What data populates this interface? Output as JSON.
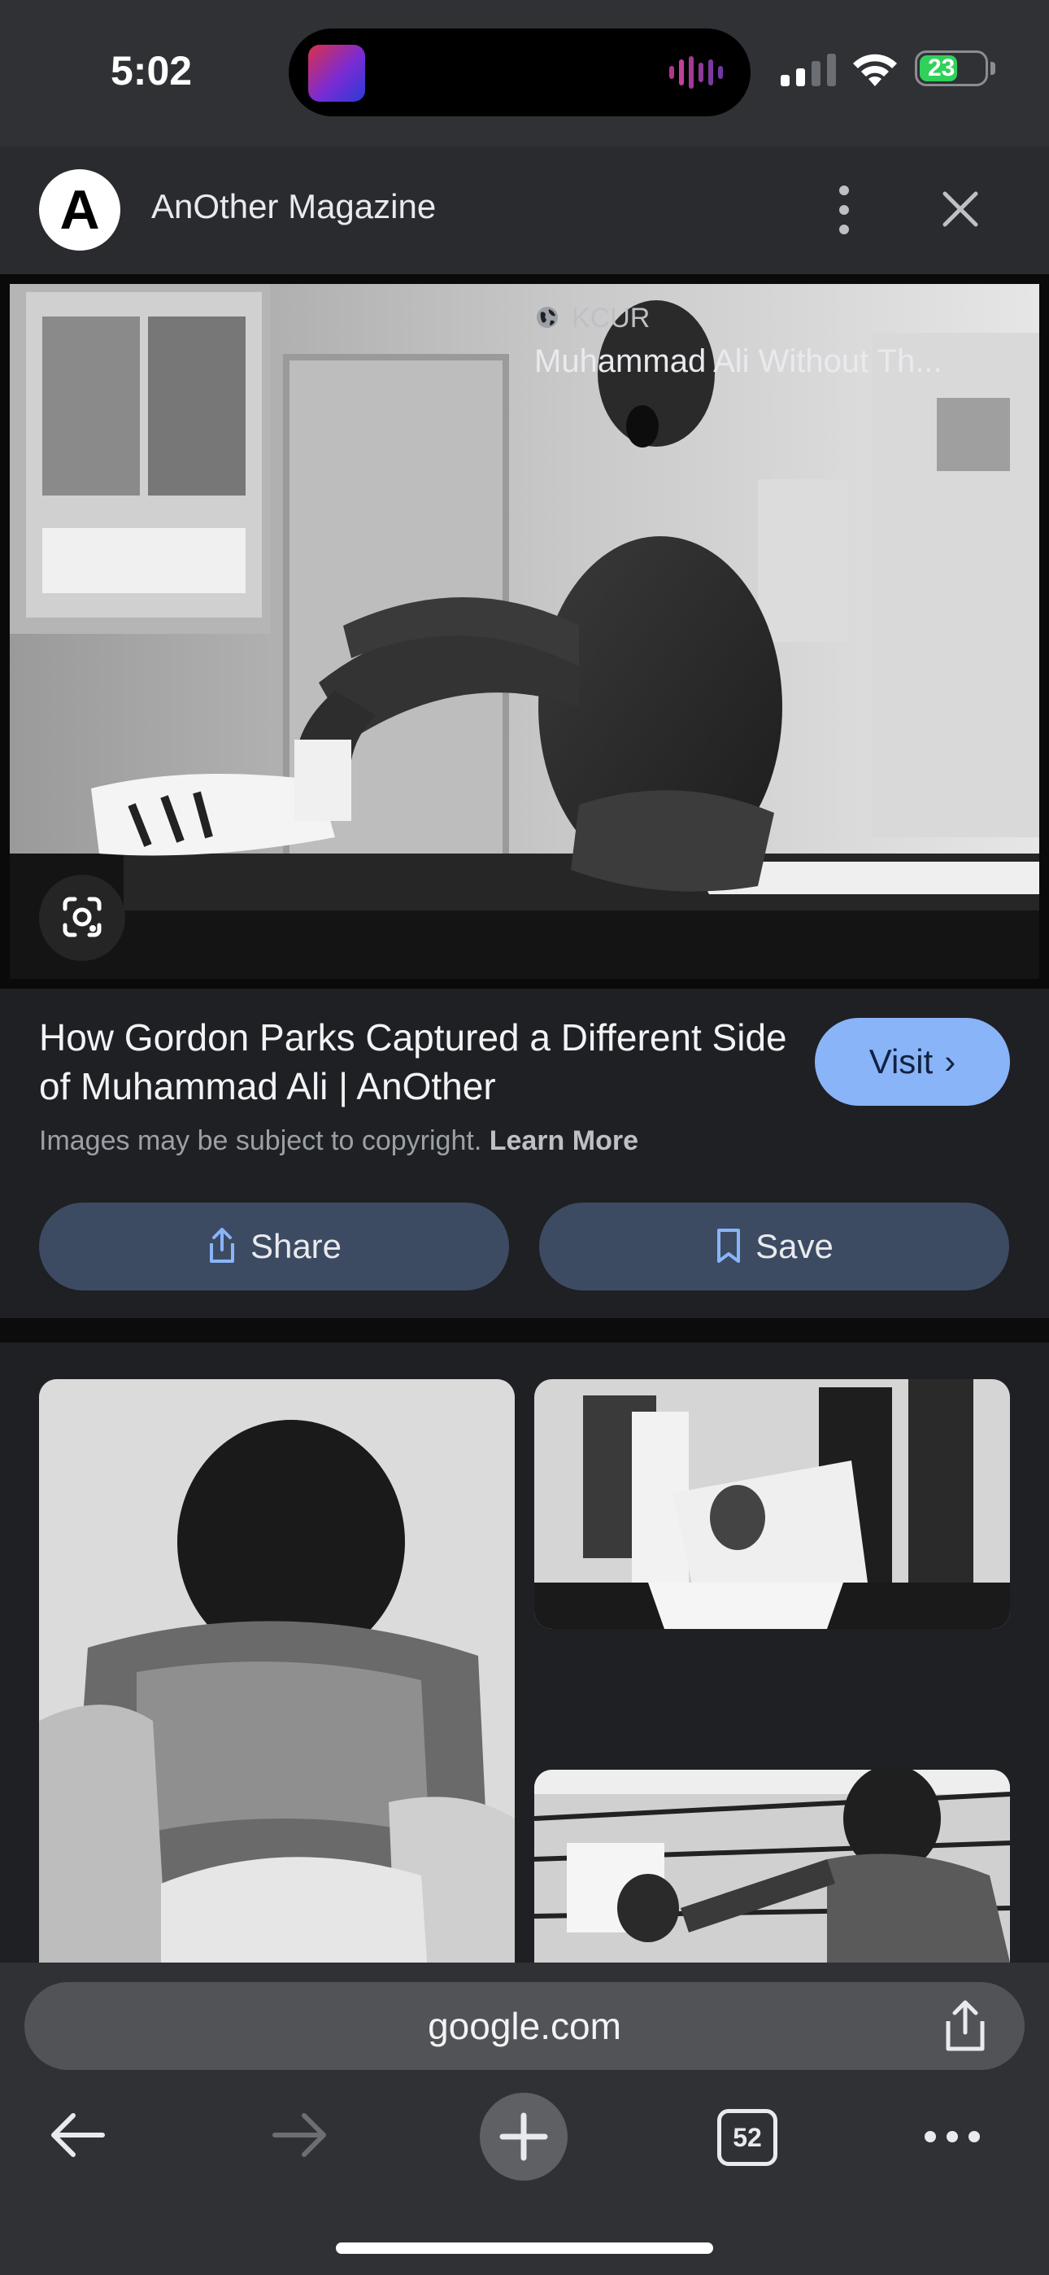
{
  "status_bar": {
    "time": "5:02",
    "battery": "23",
    "battery_color": "#30d158",
    "icons": [
      "now-playing-artwork",
      "audio-waveform-icon",
      "cellular-signal-icon",
      "wifi-icon",
      "battery-charging-icon"
    ]
  },
  "header": {
    "source_initial": "A",
    "source_name": "AnOther Magazine",
    "icons": [
      "more-vert-icon",
      "close-icon"
    ]
  },
  "main_image": {
    "subject": "Black and white photo of boxer sitting on a bench",
    "icons": [
      "lens-search-icon"
    ]
  },
  "result": {
    "title": "How Gordon Parks Captured a Different Side of Muhammad Ali | AnOther",
    "visit_label": "Visit",
    "copyright_text": "Images may be subject to copyright.",
    "learn_more": "Learn More",
    "share_label": "Share",
    "save_label": "Save",
    "accent_color": "#8ab4f8"
  },
  "related": {
    "items": [
      {
        "source": "KCUR",
        "title": "Muhammad Ali Without Th..."
      }
    ]
  },
  "browser": {
    "url": "google.com",
    "tab_count": "52",
    "icons": [
      "share-icon",
      "back-arrow-icon",
      "forward-arrow-icon",
      "plus-icon",
      "tabs-icon",
      "more-horiz-icon"
    ]
  }
}
